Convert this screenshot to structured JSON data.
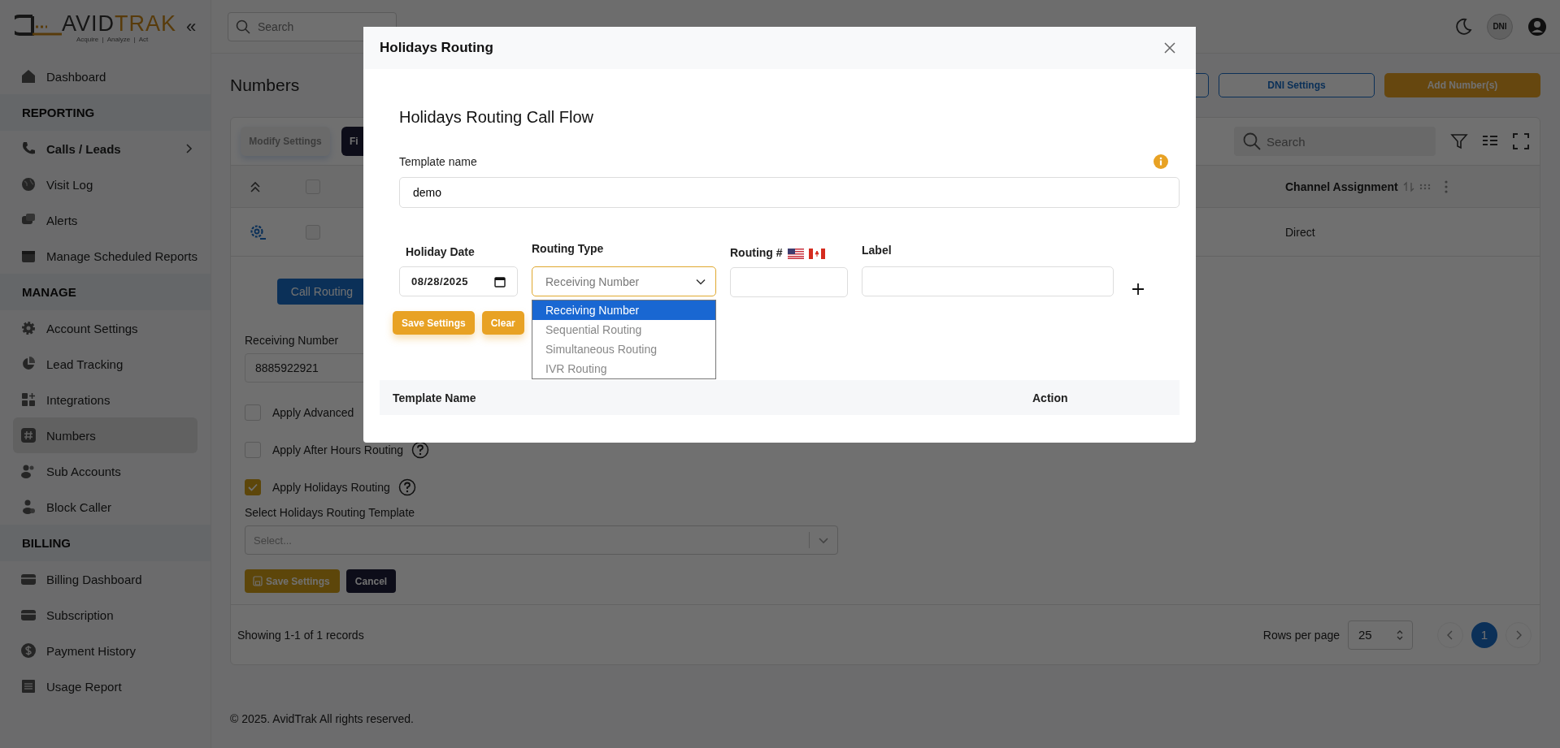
{
  "logo": {
    "word_1": "AVID",
    "word_2": "TRAK",
    "tagline": "Acquire  |  Analyze  |  Act",
    "collapse": "«"
  },
  "sidebar": {
    "items": [
      {
        "kind": "link",
        "label": "Dashboard",
        "selected": false
      },
      {
        "kind": "heading",
        "label": "REPORTING"
      },
      {
        "kind": "group",
        "label": "Calls / Leads",
        "selected": false,
        "expanded": false
      },
      {
        "kind": "link",
        "label": "Visit Log",
        "selected": false
      },
      {
        "kind": "link",
        "label": "Alerts",
        "selected": false
      },
      {
        "kind": "link",
        "label": "Manage Scheduled Reports",
        "selected": false
      },
      {
        "kind": "heading",
        "label": "MANAGE"
      },
      {
        "kind": "link",
        "label": "Account Settings",
        "selected": false
      },
      {
        "kind": "link",
        "label": "Lead Tracking",
        "selected": false
      },
      {
        "kind": "link",
        "label": "Integrations",
        "selected": false
      },
      {
        "kind": "link",
        "label": "Numbers",
        "selected": true
      },
      {
        "kind": "link",
        "label": "Sub Accounts",
        "selected": false
      },
      {
        "kind": "link",
        "label": "Block Caller",
        "selected": false
      },
      {
        "kind": "heading",
        "label": "BILLING"
      },
      {
        "kind": "link",
        "label": "Billing Dashboard",
        "selected": false
      },
      {
        "kind": "link",
        "label": "Subscription",
        "selected": false
      },
      {
        "kind": "link",
        "label": "Payment History",
        "selected": false
      },
      {
        "kind": "link",
        "label": "Usage Report",
        "selected": false
      }
    ]
  },
  "topbar": {
    "search": {
      "placeholder": "Search"
    },
    "avatar": "DNI"
  },
  "page": {
    "title": "Numbers",
    "actions": [
      {
        "kind": "outline"
      },
      {
        "kind": "outline",
        "label": "DNI Settings"
      },
      {
        "kind": "primary",
        "label": "Add Number(s)"
      }
    ]
  },
  "card": {
    "toolbar": [
      {
        "label": "Modify Settings",
        "kind": "light",
        "disabled": true
      },
      {
        "label": "Fi",
        "kind": "dark",
        "disabled": false
      }
    ],
    "search": {
      "placeholder": "Search"
    },
    "table": {
      "header_checked": false,
      "columns": [
        {
          "label": "Channel Assignment"
        }
      ],
      "rows": [
        {
          "checked": false,
          "channel_assignment": "Direct"
        }
      ]
    },
    "detail": {
      "tabs": [
        {
          "label": "Call Routing",
          "selected": true
        }
      ],
      "receiving_number": {
        "label": "Receiving Number",
        "value": "8885922921"
      },
      "options": [
        {
          "label": "Apply Advanced",
          "checked": false,
          "help": false
        },
        {
          "label": "Apply After Hours Routing",
          "checked": false,
          "help": true
        },
        {
          "label": "Apply Holidays Routing",
          "checked": true,
          "help": true
        }
      ],
      "template_select": {
        "label": "Select Holidays Routing Template",
        "placeholder": "Select..."
      },
      "buttons": [
        {
          "label": "Save Settings",
          "kind": "primary"
        },
        {
          "label": "Cancel",
          "kind": "dark"
        }
      ]
    },
    "footer": {
      "summary": "Showing 1-1 of 1 records",
      "rows_label": "Rows per page",
      "rows_value": "25",
      "pages": [
        {
          "label": "1",
          "selected": true
        }
      ]
    }
  },
  "copyright": "© 2025. AvidTrak All rights reserved.",
  "modal": {
    "title": "Holidays Routing",
    "heading": "Holidays Routing Call Flow",
    "template_name": {
      "label": "Template name",
      "value": "demo"
    },
    "fields": {
      "date_label": "Holiday Date",
      "date_value": "08/28/2025",
      "type_label": "Routing Type",
      "routing_label": "Routing #",
      "label_label": "Label"
    },
    "routing_type": {
      "value": "Receiving Number",
      "open": true,
      "options": [
        {
          "label": "Receiving Number",
          "selected": true
        },
        {
          "label": "Sequential Routing",
          "selected": false
        },
        {
          "label": "Simultaneous Routing",
          "selected": false
        },
        {
          "label": "IVR Routing",
          "selected": false
        }
      ]
    },
    "buttons": [
      {
        "label": "Save Settings"
      },
      {
        "label": "Clear"
      }
    ],
    "table_columns": [
      "Template Name",
      "Action"
    ]
  }
}
